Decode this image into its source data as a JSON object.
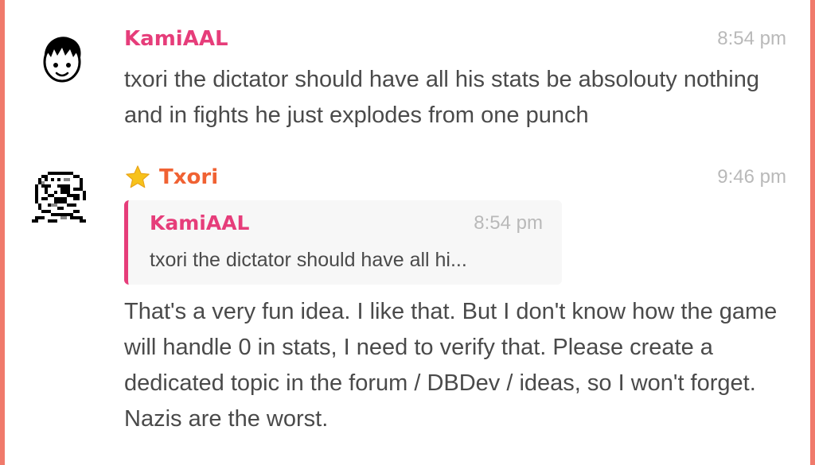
{
  "messages": [
    {
      "author": "KamiAAL",
      "time": "8:54 pm",
      "avatar_icon": "boy-face-avatar",
      "text": "txori the dictator should have all his stats be absolouty nothing and in fights he just explodes from one punch"
    },
    {
      "author": "Txori",
      "author_badge_icon": "star-icon",
      "time": "9:46 pm",
      "avatar_icon": "pixel-art-avatar",
      "reply": {
        "author": "KamiAAL",
        "time": "8:54 pm",
        "text": "txori the dictator should have all hi..."
      },
      "text": "That's a very fun idea. I like that. But I don't know how the game will handle 0 in stats, I need to verify that. Please create a dedicated topic in the forum / DBDev / ideas, so I won't forget. Nazis are the worst."
    }
  ],
  "colors": {
    "frame": "#f07a6b",
    "kami_name": "#e63d7a",
    "txori_name": "#f06233",
    "timestamp": "#b9b9b9",
    "text": "#4a4a4a",
    "quote_bg": "#f7f7f7"
  }
}
